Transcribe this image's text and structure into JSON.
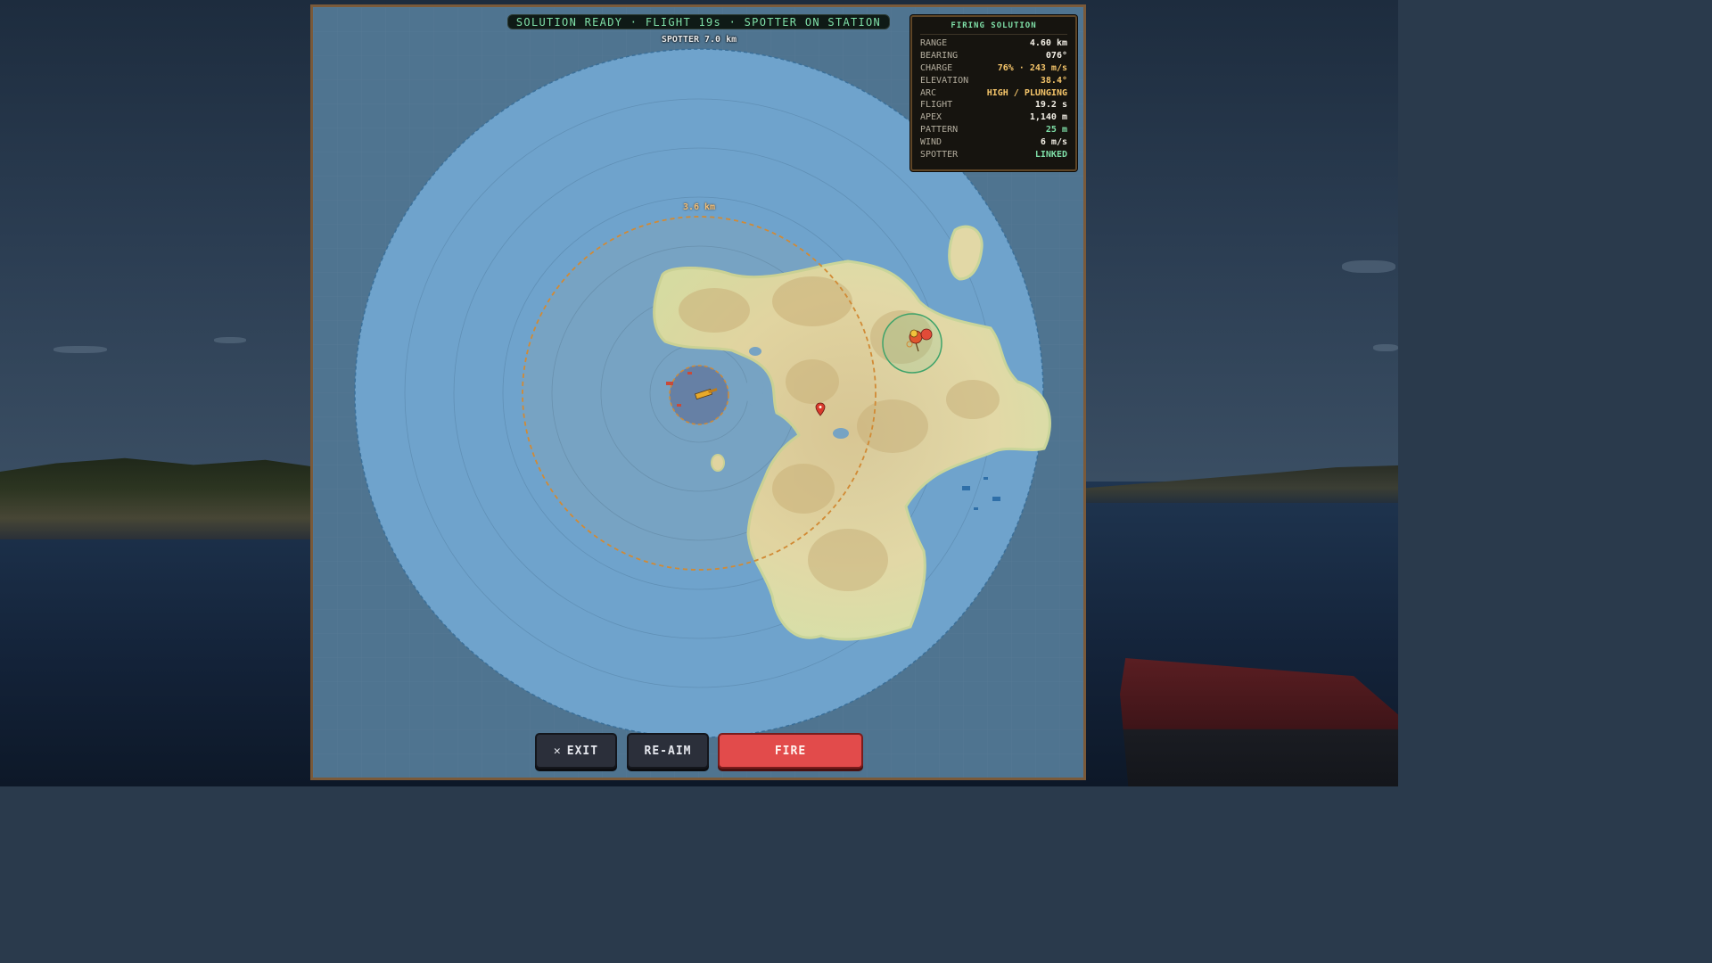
{
  "status": "SOLUTION READY · FLIGHT 19s · SPOTTER ON STATION",
  "map": {
    "spotter_ring_label": "SPOTTER 7.0 km",
    "range_ring_label": "3.6 km"
  },
  "firing_solution": {
    "title": "FIRING SOLUTION",
    "rows": [
      {
        "key": "RANGE",
        "value": "4.60 km",
        "tone": "default"
      },
      {
        "key": "BEARING",
        "value": "076°",
        "tone": "default"
      },
      {
        "key": "CHARGE",
        "value": "76% · 243 m/s",
        "tone": "warm"
      },
      {
        "key": "ELEVATION",
        "value": "38.4°",
        "tone": "warm"
      },
      {
        "key": "ARC",
        "value": "HIGH / PLUNGING",
        "tone": "warm"
      },
      {
        "key": "FLIGHT",
        "value": "19.2 s",
        "tone": "default"
      },
      {
        "key": "APEX",
        "value": "1,140 m",
        "tone": "default"
      },
      {
        "key": "PATTERN",
        "value": "25 m",
        "tone": "green"
      },
      {
        "key": "WIND",
        "value": "6 m/s",
        "tone": "default"
      },
      {
        "key": "SPOTTER",
        "value": "LINKED",
        "tone": "green"
      }
    ]
  },
  "buttons": {
    "exit_glyph": "✕",
    "exit_label": "EXIT",
    "reaim_label": "RE-AIM",
    "fire_label": "FIRE"
  },
  "colors": {
    "accent_green": "#7fe0a8",
    "accent_warm": "#f5c56a",
    "fire_red": "#e24b4b",
    "range_ring": "#d18a35",
    "spotter_ring": "#3b6f98"
  },
  "icons": {
    "ship": "artillery-ship-icon",
    "target": "target-marker-icon",
    "waypoint": "map-pin-icon"
  }
}
